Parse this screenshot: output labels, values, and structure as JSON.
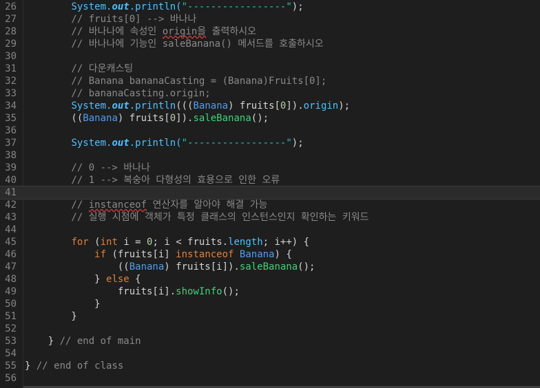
{
  "editor": {
    "current_line": 41,
    "lines": [
      {
        "n": 26,
        "segs": [
          [
            "",
            "        "
          ],
          [
            "fn",
            "System."
          ],
          [
            "st",
            "out"
          ],
          [
            "fn",
            ".println("
          ],
          [
            "str",
            "\"-----------------\""
          ],
          [
            "pl",
            ");"
          ]
        ]
      },
      {
        "n": 27,
        "segs": [
          [
            "cm",
            "        // fruits[0] --> 바나나"
          ]
        ]
      },
      {
        "n": 28,
        "segs": [
          [
            "cm",
            "        // 바나나에 속성인 "
          ],
          [
            "cm sq",
            "origin을"
          ],
          [
            "cm",
            " 출력하시오"
          ]
        ]
      },
      {
        "n": 29,
        "segs": [
          [
            "cm",
            "        // 바나나에 기능인 saleBanana() 메서드를 호출하시오"
          ]
        ]
      },
      {
        "n": 30,
        "segs": []
      },
      {
        "n": 31,
        "segs": [
          [
            "cm",
            "        // 다운캐스팅"
          ]
        ]
      },
      {
        "n": 32,
        "segs": [
          [
            "cm",
            "        // Banana bananaCasting = (Banana)Fruits[0];"
          ]
        ]
      },
      {
        "n": 33,
        "segs": [
          [
            "cm",
            "        // bananaCasting.origin;"
          ]
        ]
      },
      {
        "n": 34,
        "segs": [
          [
            "",
            "        "
          ],
          [
            "fn",
            "System."
          ],
          [
            "st",
            "out"
          ],
          [
            "fn",
            ".println"
          ],
          [
            "pl",
            "((("
          ],
          [
            "tp",
            "Banana"
          ],
          [
            "pl",
            ") fruits["
          ],
          [
            "nm",
            "0"
          ],
          [
            "pl",
            "])."
          ],
          [
            "fn",
            "origin"
          ],
          [
            "pl",
            ");"
          ]
        ]
      },
      {
        "n": 35,
        "segs": [
          [
            "pl",
            "        (("
          ],
          [
            "tp",
            "Banana"
          ],
          [
            "pl",
            ") fruits["
          ],
          [
            "nm",
            "0"
          ],
          [
            "pl",
            "])."
          ],
          [
            "mt",
            "saleBanana"
          ],
          [
            "pl",
            "();"
          ]
        ]
      },
      {
        "n": 36,
        "segs": []
      },
      {
        "n": 37,
        "segs": [
          [
            "",
            "        "
          ],
          [
            "fn",
            "System."
          ],
          [
            "st",
            "out"
          ],
          [
            "fn",
            ".println("
          ],
          [
            "str",
            "\"-----------------\""
          ],
          [
            "pl",
            ");"
          ]
        ]
      },
      {
        "n": 38,
        "segs": []
      },
      {
        "n": 39,
        "segs": [
          [
            "cm",
            "        // 0 --> 바나나"
          ]
        ]
      },
      {
        "n": 40,
        "segs": [
          [
            "cm",
            "        // 1 --> 복숭아 다형성의 효용으로 인한 오류"
          ]
        ]
      },
      {
        "n": 41,
        "segs": []
      },
      {
        "n": 42,
        "segs": [
          [
            "cm",
            "        // "
          ],
          [
            "cm sq",
            "instanceof"
          ],
          [
            "cm",
            " 연산자를 알아야 해결 가능"
          ]
        ]
      },
      {
        "n": 43,
        "segs": [
          [
            "cm",
            "        // 실행 시점에 객체가 특정 클래스의 인스턴스인지 확인하는 키워드"
          ]
        ]
      },
      {
        "n": 44,
        "segs": []
      },
      {
        "n": 45,
        "segs": [
          [
            "",
            "        "
          ],
          [
            "kw",
            "for"
          ],
          [
            "pl",
            " ("
          ],
          [
            "kw",
            "int"
          ],
          [
            "pl",
            " i = "
          ],
          [
            "nm",
            "0"
          ],
          [
            "pl",
            "; i < fruits."
          ],
          [
            "fn",
            "length"
          ],
          [
            "pl",
            "; i++) {"
          ]
        ]
      },
      {
        "n": 46,
        "segs": [
          [
            "",
            "            "
          ],
          [
            "kw",
            "if"
          ],
          [
            "pl",
            " (fruits[i] "
          ],
          [
            "kw",
            "instanceof"
          ],
          [
            "pl",
            " "
          ],
          [
            "tp",
            "Banana"
          ],
          [
            "pl",
            ") {"
          ]
        ]
      },
      {
        "n": 47,
        "segs": [
          [
            "pl",
            "                (("
          ],
          [
            "tp",
            "Banana"
          ],
          [
            "pl",
            ") fruits[i])."
          ],
          [
            "mt",
            "saleBanana"
          ],
          [
            "pl",
            "();"
          ]
        ]
      },
      {
        "n": 48,
        "segs": [
          [
            "pl",
            "            } "
          ],
          [
            "kw",
            "else"
          ],
          [
            "pl",
            " {"
          ]
        ]
      },
      {
        "n": 49,
        "segs": [
          [
            "pl",
            "                fruits[i]."
          ],
          [
            "mt",
            "showInfo"
          ],
          [
            "pl",
            "();"
          ]
        ]
      },
      {
        "n": 50,
        "segs": [
          [
            "pl",
            "            }"
          ]
        ]
      },
      {
        "n": 51,
        "segs": [
          [
            "pl",
            "        }"
          ]
        ]
      },
      {
        "n": 52,
        "segs": []
      },
      {
        "n": 53,
        "segs": [
          [
            "pl",
            "    } "
          ],
          [
            "cm",
            "// end of main"
          ]
        ]
      },
      {
        "n": 54,
        "segs": []
      },
      {
        "n": 55,
        "segs": [
          [
            "pl",
            "} "
          ],
          [
            "cm",
            "// end of class"
          ]
        ]
      },
      {
        "n": 56,
        "segs": []
      }
    ]
  }
}
